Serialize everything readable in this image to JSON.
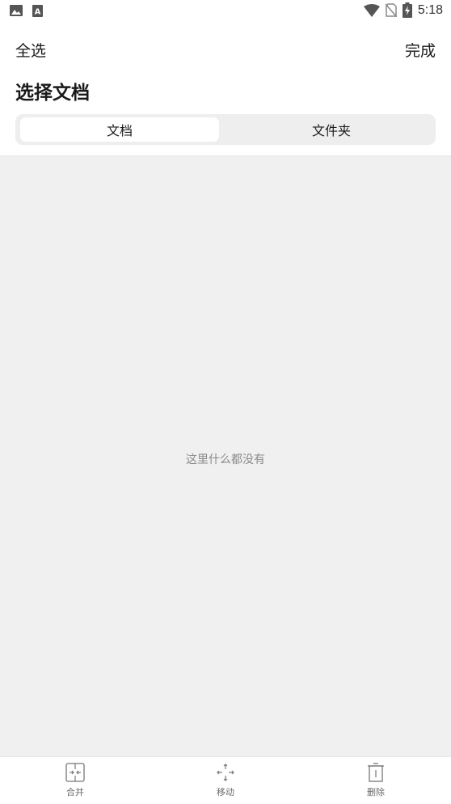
{
  "status_bar": {
    "time": "5:18",
    "icons": [
      "image-icon",
      "a-letter-icon",
      "wifi-icon",
      "no-sim-icon",
      "battery-charging-icon"
    ]
  },
  "header": {
    "select_all": "全选",
    "done": "完成"
  },
  "title": "选择文档",
  "tabs": [
    {
      "label": "文档",
      "active": true
    },
    {
      "label": "文件夹",
      "active": false
    }
  ],
  "empty_state": {
    "text": "这里什么都没有"
  },
  "toolbar": {
    "items": [
      {
        "label": "合并",
        "icon": "merge-icon"
      },
      {
        "label": "移动",
        "icon": "move-icon"
      },
      {
        "label": "删除",
        "icon": "trash-icon"
      }
    ]
  },
  "colors": {
    "background": "#ffffff",
    "content_bg": "#f0f0f0",
    "tab_track": "#eeeeee",
    "text_primary": "#1a1a1a",
    "text_muted": "#8a8a8a"
  }
}
